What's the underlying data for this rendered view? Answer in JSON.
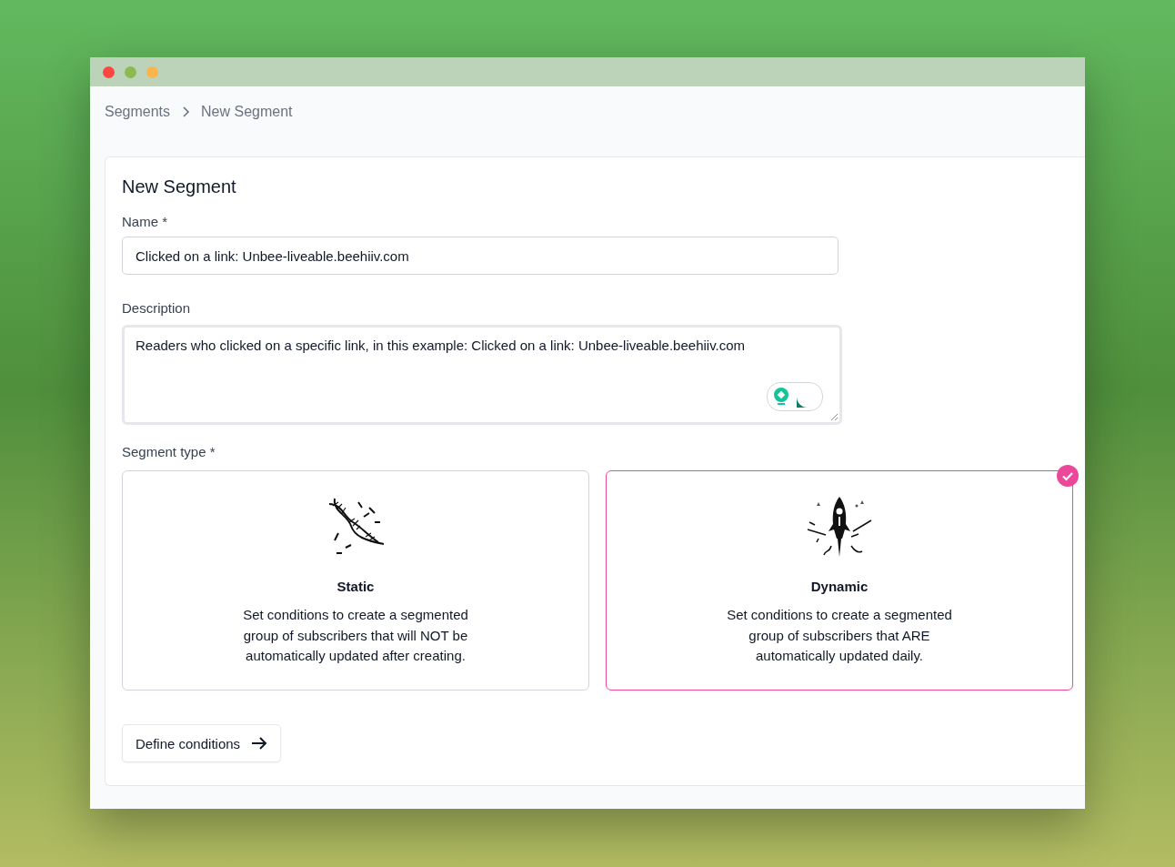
{
  "breadcrumb": [
    {
      "label": "Segments"
    },
    {
      "label": "New Segment"
    }
  ],
  "form": {
    "title": "New Segment",
    "name": {
      "label": "Name *",
      "value": "Clicked on a link: Unbee-liveable.beehiiv.com"
    },
    "description": {
      "label": "Description",
      "value": "Readers who clicked on a specific link, in this example: Clicked on a link: Unbee-liveable.beehiiv.com"
    },
    "segment_type": {
      "label": "Segment type *",
      "options": [
        {
          "kind": "static",
          "title": "Static",
          "text": "Set conditions to create a segmented group of subscribers that will NOT be automatically updated after creating.",
          "selected": false
        },
        {
          "kind": "dynamic",
          "title": "Dynamic",
          "text": "Set conditions to create a segmented group of subscribers that ARE automatically updated daily.",
          "selected": true
        }
      ]
    },
    "button": "Define conditions"
  }
}
